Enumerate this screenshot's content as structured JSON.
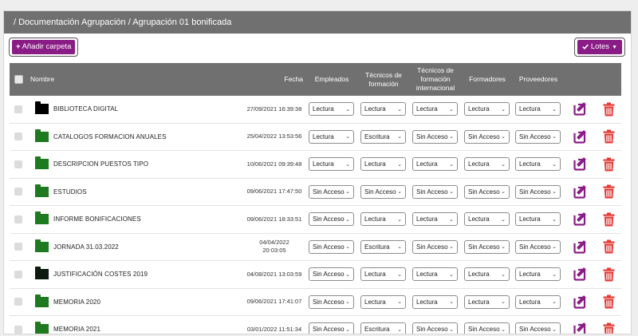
{
  "breadcrumb": "/ Documentación Agrupación / Agrupación 01 bonificada",
  "toolbar": {
    "add_folder_label": "Añadir carpeta",
    "add_icon": "+",
    "batch_label": "Lotes",
    "batch_icon": "check-icon"
  },
  "colors": {
    "accent": "#8a1c86",
    "header_bg": "#707070",
    "folder_green": "#1e7a1e",
    "folder_dark": "#0e1a0e",
    "delete_red": "#e53935"
  },
  "table": {
    "headers": {
      "name": "Nombre",
      "date": "Fecha",
      "employees": "Empleados",
      "training_tech": "Técnicos de formación",
      "intl_training_tech": "Técnicos de formación internacional",
      "trainers": "Formadores",
      "suppliers": "Proveedores"
    },
    "rows": [
      {
        "name": "BIBLIOTECA DIGITAL",
        "folder_color": "#000000",
        "date": "27/09/2021 16:39:38",
        "perms": [
          "Lectura",
          "Lectura",
          "Lectura",
          "Lectura",
          "Lectura"
        ]
      },
      {
        "name": "CATALOGOS FORMACION ANUALES",
        "folder_color": "#1e7a1e",
        "date": "25/04/2022 13:53:56",
        "perms": [
          "Lectura",
          "Escritura",
          "Sin Acceso",
          "Sin Acceso",
          "Sin Acceso"
        ]
      },
      {
        "name": "DESCRIPCION PUESTOS TIPO",
        "folder_color": "#1e7a1e",
        "date": "10/06/2021 09:39:48",
        "perms": [
          "Lectura",
          "Lectura",
          "Lectura",
          "Lectura",
          "Lectura"
        ]
      },
      {
        "name": "ESTUDIOS",
        "folder_color": "#1e7a1e",
        "date": "09/06/2021 17:47:50",
        "perms": [
          "Sin Acceso",
          "Sin Acceso",
          "Sin Acceso",
          "Sin Acceso",
          "Sin Acceso"
        ]
      },
      {
        "name": "INFORME BONIFICACIONES",
        "folder_color": "#1e7a1e",
        "date": "09/06/2021 18:33:51",
        "perms": [
          "Sin Acceso",
          "Lectura",
          "Lectura",
          "Lectura",
          "Lectura"
        ]
      },
      {
        "name": "JORNADA 31.03.2022",
        "folder_color": "#1e7a1e",
        "date": "04/04/2022 20:03:05",
        "perms": [
          "Sin Acceso",
          "Escritura",
          "Sin Acceso",
          "Sin Acceso",
          "Sin Acceso"
        ]
      },
      {
        "name": "JUSTIFICACIÓN COSTES 2019",
        "folder_color": "#0e1a0e",
        "date": "04/08/2021 13:03:59",
        "perms": [
          "Sin Acceso",
          "Lectura",
          "Lectura",
          "Lectura",
          "Lectura"
        ]
      },
      {
        "name": "MEMORIA 2020",
        "folder_color": "#1e7a1e",
        "date": "09/06/2021 17:41:07",
        "perms": [
          "Sin Acceso",
          "Lectura",
          "Lectura",
          "Lectura",
          "Lectura"
        ]
      },
      {
        "name": "MEMORIA 2021",
        "folder_color": "#1e7a1e",
        "date": "03/01/2022 11:51:34",
        "perms": [
          "Sin Acceso",
          "Escritura",
          "Sin Acceso",
          "Sin Acceso",
          "Sin Acceso"
        ]
      }
    ]
  }
}
